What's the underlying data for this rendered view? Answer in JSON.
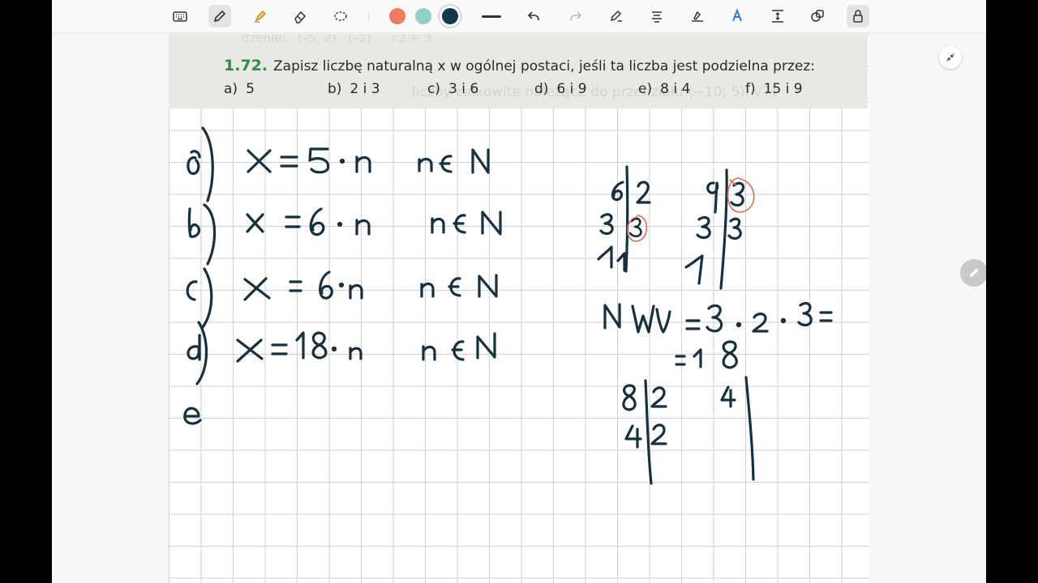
{
  "toolbar": {
    "tools": [
      "keyboard-icon",
      "pen-icon",
      "highlighter-icon",
      "eraser-icon",
      "lasso-icon"
    ],
    "colors": [
      "#ee7b62",
      "#8fd1c4",
      "#0f3a4a"
    ],
    "selected_color": "#0f3a4a",
    "actions": [
      "line-width-icon",
      "undo-icon",
      "redo-icon",
      "pen-settings-icon",
      "text-icon",
      "handwriting-icon",
      "shape-icon",
      "spacing-icon",
      "shapes-icon",
      "lock-icon"
    ]
  },
  "exercise": {
    "number": "1.72.",
    "question": "Zapisz liczbę naturalną x w ogólnej postaci, jeśli ta liczba jest podzielna przez:",
    "options": [
      {
        "label": "a)",
        "value": "5"
      },
      {
        "label": "b)",
        "value": "2 i 3"
      },
      {
        "label": "c)",
        "value": "3 i 6"
      },
      {
        "label": "d)",
        "value": "6 i 9"
      },
      {
        "label": "e)",
        "value": "8 i 4"
      },
      {
        "label": "f)",
        "value": "15 i 9"
      }
    ],
    "background_text": "liczby całkowite należące do przedziału ⟨−10; 5⟩, √7⟩"
  },
  "handwriting": {
    "answers": [
      {
        "label": "a",
        "formula": "x = 5 · n",
        "domain": "n ∈ N"
      },
      {
        "label": "b",
        "formula": "x = 6 · n",
        "domain": "n ∈ N"
      },
      {
        "label": "c",
        "formula": "x = 6 · n",
        "domain": "n ∈ N"
      },
      {
        "label": "d",
        "formula": "x = 18 · n",
        "domain": "n ∈ N"
      },
      {
        "label": "e",
        "formula": "",
        "domain": ""
      }
    ],
    "lcm_note": "NWW = 3 · 2 · 3 = 18",
    "factorizations": [
      "6 | 2, 3 | 3, 1",
      "9 | 3, 3 | 3, 1",
      "8 | 2, 4 | 2",
      "4 |"
    ]
  },
  "side_controls": [
    "collapse-icon",
    "edit-fab-icon"
  ]
}
